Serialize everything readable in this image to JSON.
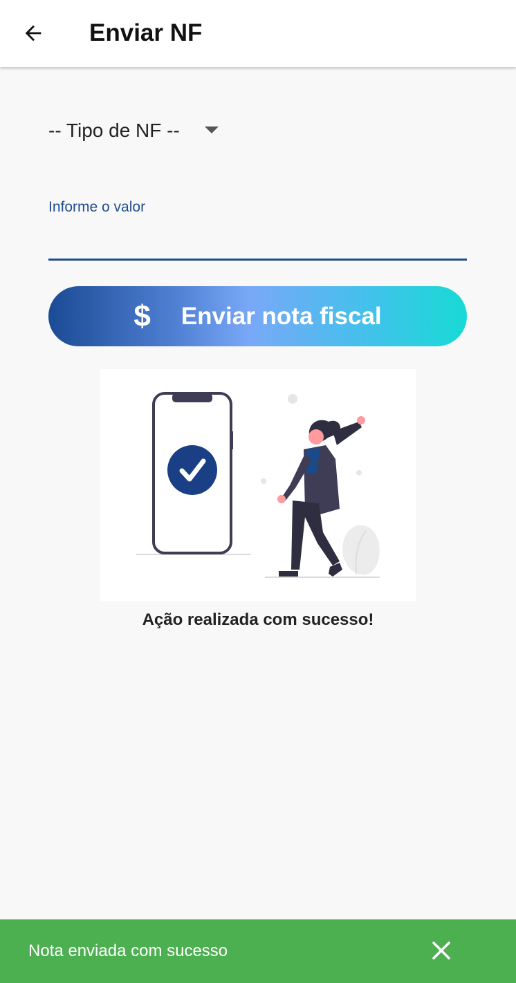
{
  "appbar": {
    "title": "Enviar NF",
    "back_icon": "arrow-left-icon"
  },
  "form": {
    "type_select": {
      "selected": "-- Tipo de NF --",
      "caret_icon": "caret-down-icon"
    },
    "value_field": {
      "label": "Informe o valor",
      "value": ""
    },
    "send_button": {
      "icon_glyph": "$",
      "icon": "dollar-icon",
      "label": "Enviar nota fiscal"
    }
  },
  "result": {
    "message": "Ação realizada com sucesso!",
    "illustration": "phone-check-woman-celebrating-illustration"
  },
  "snackbar": {
    "message": "Nota enviada com sucesso",
    "close_icon": "close-icon"
  },
  "colors": {
    "primary": "#1e4d8c",
    "success": "#4caf50",
    "gradient": [
      "#1b4b94",
      "#79a8f7",
      "#17dad5"
    ],
    "background": "#f8f8f8"
  }
}
